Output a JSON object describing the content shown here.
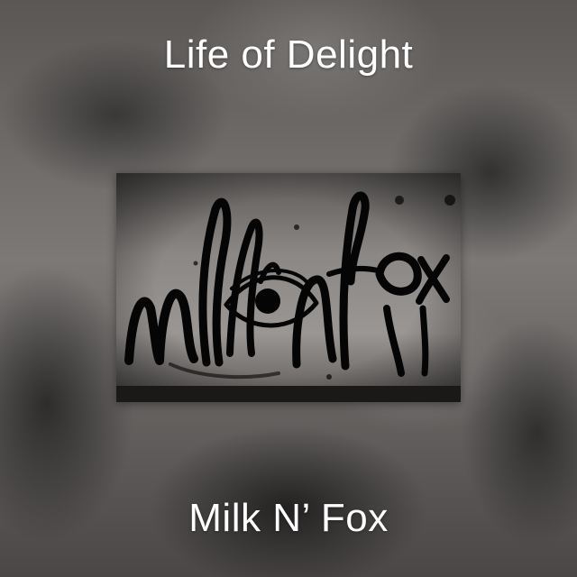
{
  "album": {
    "title": "Life of Delight",
    "artist": "Milk N’ Fox"
  },
  "artwork": {
    "description_icon": "graffiti-logo-artwork",
    "logo_text": "milknfox"
  },
  "colors": {
    "text": "#ffffff",
    "artwork_bg": "#8a8684",
    "ink": "#050505"
  }
}
